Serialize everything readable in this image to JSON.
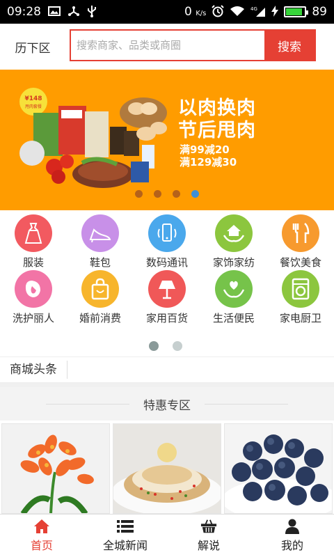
{
  "status_bar": {
    "time": "09:28",
    "network": "0",
    "network_unit": "K/s",
    "signal_type": "4G",
    "battery": "89",
    "icons": [
      "image-icon",
      "usb-share-icon",
      "usb-icon",
      "alarm-icon",
      "wifi-icon",
      "signal-icon",
      "charging-icon",
      "battery-icon"
    ]
  },
  "header": {
    "location": "历下区",
    "search_placeholder": "搜索商家、品类或商圈",
    "search_button": "搜索"
  },
  "banner": {
    "title_line1": "以肉换肉",
    "title_line2": "节后甩肉",
    "promo_line1": "满99减20",
    "promo_line2": "满129减30",
    "price_tag": "¥148",
    "price_tag_sub": "甩肉套餐",
    "slide_count": 4,
    "active_slide": 4
  },
  "categories": [
    {
      "label": "服装",
      "icon": "dress-icon",
      "color": "#f25a60"
    },
    {
      "label": "鞋包",
      "icon": "high-heel-icon",
      "color": "#c890e8"
    },
    {
      "label": "数码通讯",
      "icon": "phone-icon",
      "color": "#4aa8ec"
    },
    {
      "label": "家饰家纺",
      "icon": "home-hands-icon",
      "color": "#8cc63e"
    },
    {
      "label": "餐饮美食",
      "icon": "fork-knife-icon",
      "color": "#f79a2e"
    },
    {
      "label": "洗护丽人",
      "icon": "woman-face-icon",
      "color": "#f274a6"
    },
    {
      "label": "婚前消费",
      "icon": "shopping-bag-icon",
      "color": "#f7b52c"
    },
    {
      "label": "家用百货",
      "icon": "lamp-icon",
      "color": "#f05858"
    },
    {
      "label": "生活便民",
      "icon": "heart-hands-icon",
      "color": "#76c34a"
    },
    {
      "label": "家电厨卫",
      "icon": "washing-machine-icon",
      "color": "#8cc63e"
    }
  ],
  "category_pages": {
    "count": 2,
    "active": 1
  },
  "headline": {
    "label": "商城头条"
  },
  "special": {
    "title": "特惠专区"
  },
  "products": [
    {
      "name": "clivia-flower-image"
    },
    {
      "name": "dessert-plate-image"
    },
    {
      "name": "blueberries-image"
    }
  ],
  "tabbar": {
    "tabs": [
      {
        "label": "首页",
        "icon": "home-icon",
        "active": true
      },
      {
        "label": "全城新闻",
        "icon": "list-icon",
        "active": false
      },
      {
        "label": "解说",
        "icon": "basket-icon",
        "active": false
      },
      {
        "label": "我的",
        "icon": "user-icon",
        "active": false
      }
    ]
  },
  "colors": {
    "accent": "#e54034",
    "banner_bg": "#ff9c00",
    "active_tab": "#e54034"
  }
}
